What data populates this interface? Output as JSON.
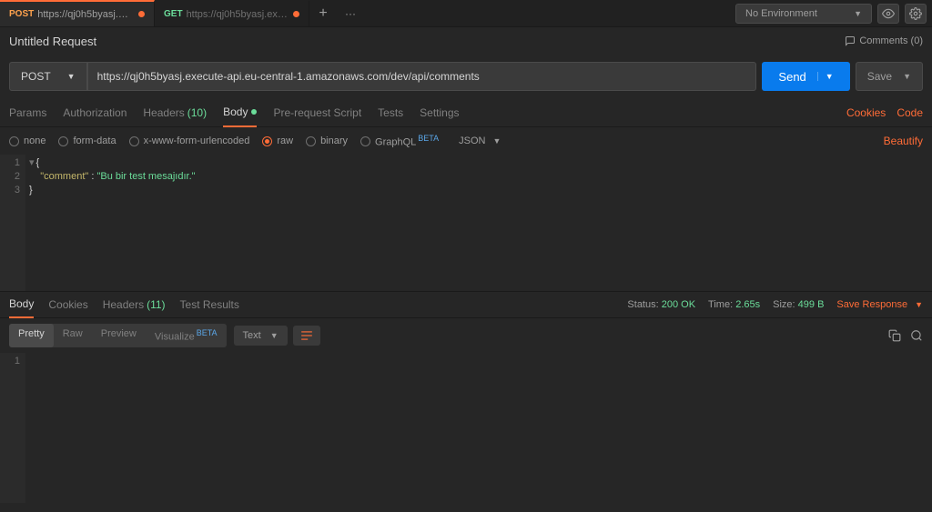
{
  "topbar": {
    "tabs": [
      {
        "method": "POST",
        "title": "https://qj0h5byasj.execute-api...",
        "modified": true,
        "active": true
      },
      {
        "method": "GET",
        "title": "https://qj0h5byasj.execute-api...",
        "modified": true,
        "active": false
      }
    ],
    "env_label": "No Environment"
  },
  "title": {
    "name": "Untitled Request",
    "comments": "Comments (0)"
  },
  "request": {
    "method": "POST",
    "url": "https://qj0h5byasj.execute-api.eu-central-1.amazonaws.com/dev/api/comments",
    "send": "Send",
    "save": "Save"
  },
  "req_tabs": {
    "params": "Params",
    "auth": "Authorization",
    "headers": "Headers",
    "headers_count": "(10)",
    "body": "Body",
    "prerequest": "Pre-request Script",
    "tests": "Tests",
    "settings": "Settings",
    "cookies": "Cookies",
    "code": "Code"
  },
  "body_types": {
    "none": "none",
    "formdata": "form-data",
    "urlenc": "x-www-form-urlencoded",
    "raw": "raw",
    "binary": "binary",
    "graphql": "GraphQL",
    "beta": "BETA",
    "format": "JSON",
    "beautify": "Beautify"
  },
  "body_content": {
    "lines": [
      "1",
      "2",
      "3"
    ],
    "l1": "{",
    "l2_indent": "    ",
    "l2_key": "\"comment\"",
    "l2_sep": " : ",
    "l2_val": "\"Bu bir test mesajıdır.\"",
    "l3": "}"
  },
  "response": {
    "tabs": {
      "body": "Body",
      "cookies": "Cookies",
      "headers": "Headers",
      "headers_count": "(11)",
      "tests": "Test Results"
    },
    "status_label": "Status:",
    "status_val": "200 OK",
    "time_label": "Time:",
    "time_val": "2.65s",
    "size_label": "Size:",
    "size_val": "499 B",
    "save_response": "Save Response"
  },
  "resp_toolbar": {
    "pretty": "Pretty",
    "raw": "Raw",
    "preview": "Preview",
    "visualize": "Visualize",
    "beta": "BETA",
    "text": "Text"
  },
  "resp_body": {
    "line1": "1"
  }
}
